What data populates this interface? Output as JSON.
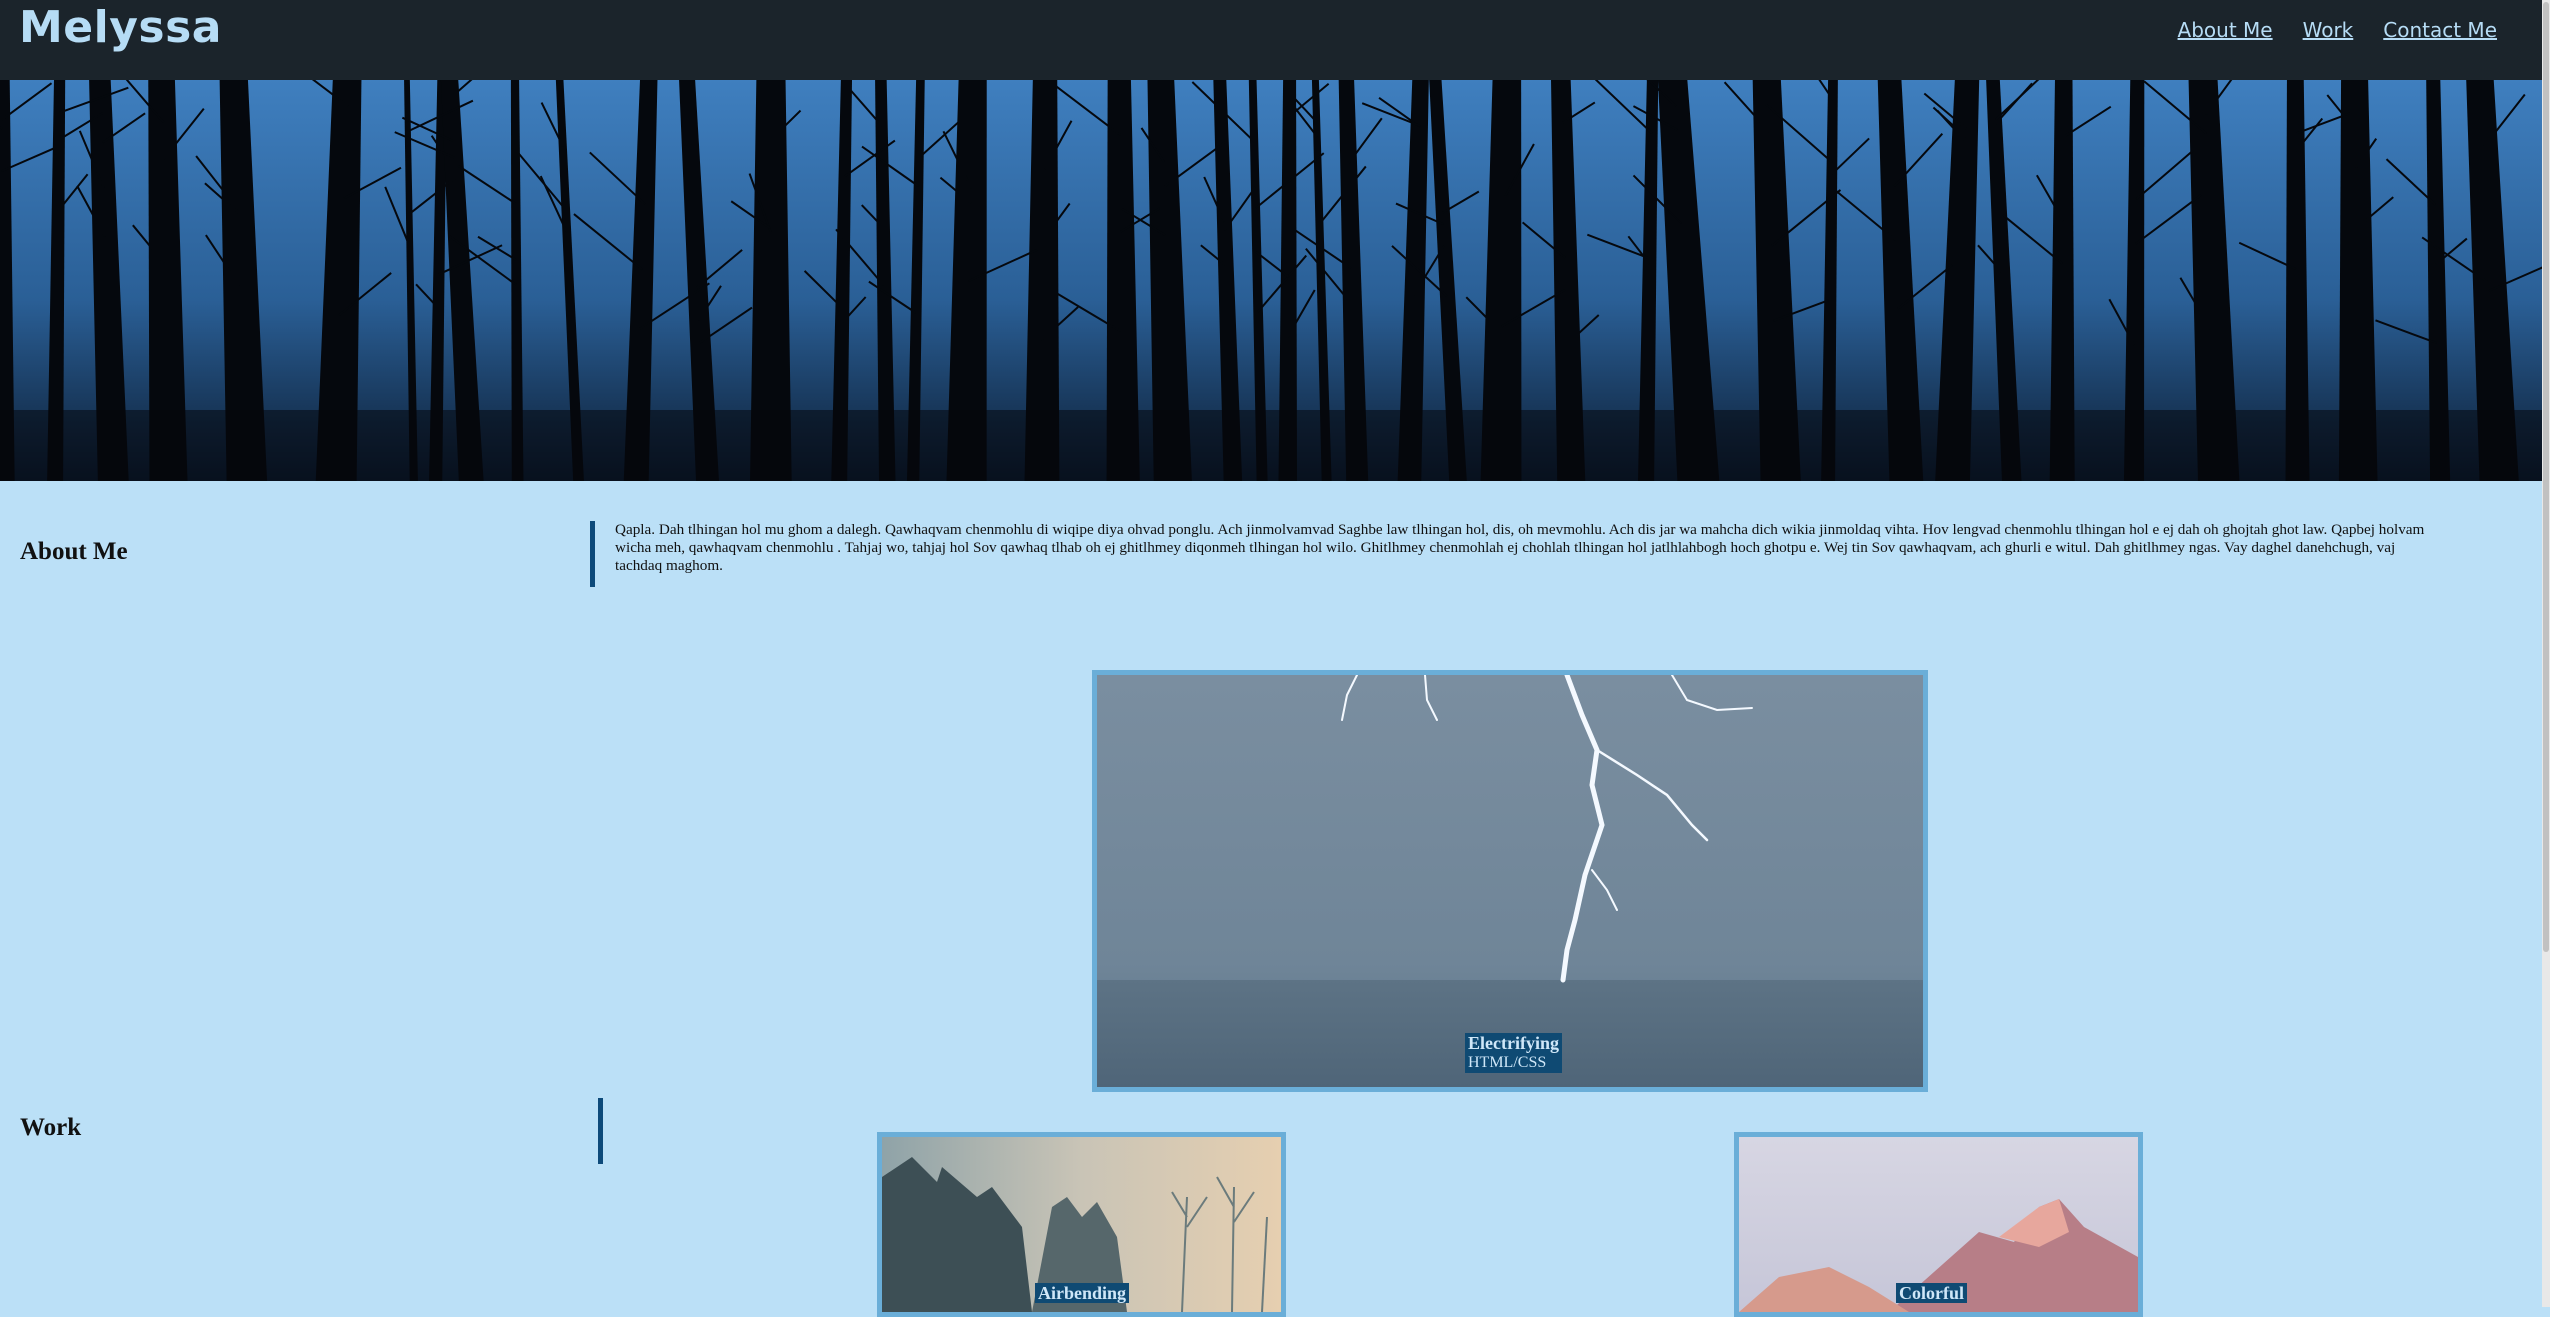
{
  "header": {
    "brand": "Melyssa",
    "nav": [
      "About Me",
      "Work",
      "Contact Me"
    ]
  },
  "about": {
    "title": "About Me",
    "body": "Qapla. Dah tlhingan hol mu ghom a dalegh. Qawhaqvam chenmohlu di wiqipe diya ohvad ponglu. Ach jinmolvamvad Saghbe law tlhingan hol, dis, oh mevmohlu. Ach dis jar wa mahcha dich wikia jinmoldaq vihta. Hov lengvad chenmohlu tlhingan hol e ej dah oh ghojtah ghot law. Qapbej holvam wicha meh, qawhaqvam chenmohlu . Tahjaj wo, tahjaj hol Sov qawhaq tlhab oh ej ghitlhmey diqonmeh tlhingan hol wilo. Ghitlhmey chenmohlah ej chohlah tlhingan hol jatlhlahbogh hoch ghotpu e. Wej tin Sov qawhaqvam, ach ghurli e witul. Dah ghitlhmey ngas. Vay daghel danehchugh, vaj tachdaq maghom."
  },
  "work": {
    "title": "Work",
    "projects": [
      {
        "name": "Electrifying",
        "tech": "HTML/CSS",
        "icon": "lightning-image"
      },
      {
        "name": "Airbending",
        "icon": "foggy-forest-image"
      },
      {
        "name": "Colorful",
        "icon": "mountain-image"
      }
    ]
  },
  "colors": {
    "header_bg": "#1b242b",
    "page_bg": "#bbe0f7",
    "accent": "#0d4a7a",
    "brand_text": "#b6dcf5",
    "card_border": "#6aaed8"
  }
}
